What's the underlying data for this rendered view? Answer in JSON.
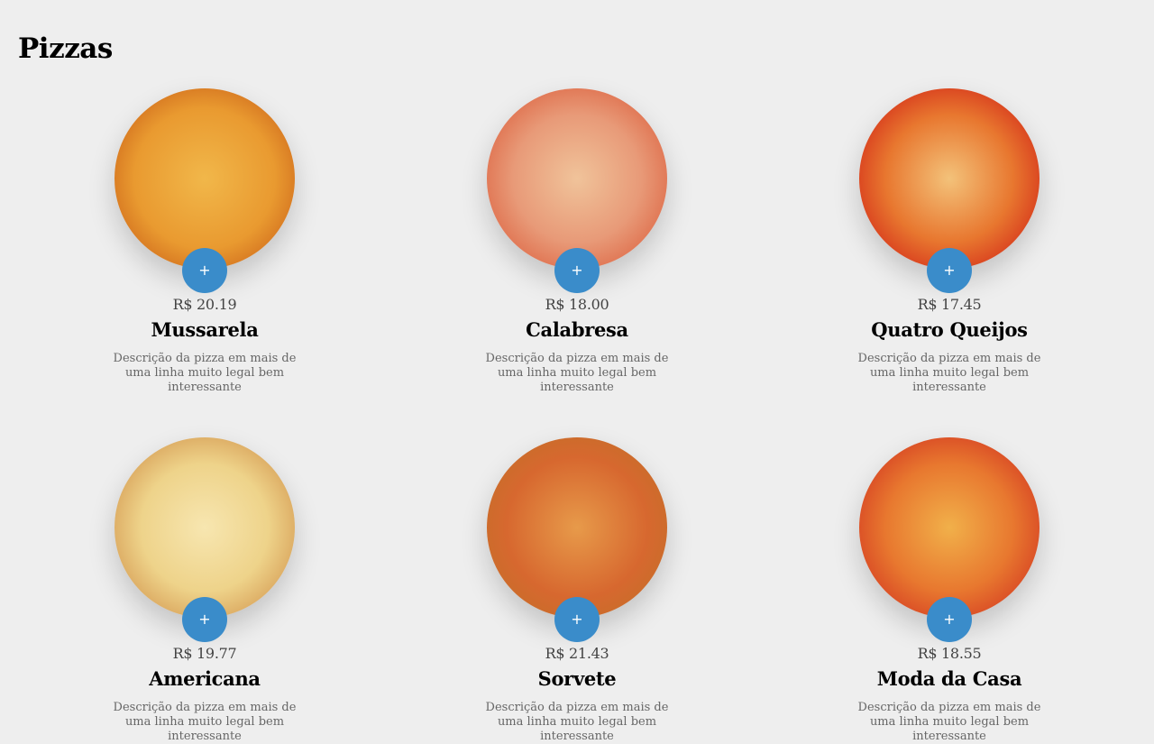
{
  "page": {
    "title": "Pizzas"
  },
  "add_label": "+",
  "colors": {
    "background": "#eeeeee",
    "add_button": "#3a8cca"
  },
  "pizzas": [
    {
      "price": "R$ 20.19",
      "name": "Mussarela",
      "description": "Descrição da pizza em mais de uma linha muito legal bem interessante"
    },
    {
      "price": "R$ 18.00",
      "name": "Calabresa",
      "description": "Descrição da pizza em mais de uma linha muito legal bem interessante"
    },
    {
      "price": "R$ 17.45",
      "name": "Quatro Queijos",
      "description": "Descrição da pizza em mais de uma linha muito legal bem interessante"
    },
    {
      "price": "R$ 19.77",
      "name": "Americana",
      "description": "Descrição da pizza em mais de uma linha muito legal bem interessante"
    },
    {
      "price": "R$ 21.43",
      "name": "Sorvete",
      "description": "Descrição da pizza em mais de uma linha muito legal bem interessante"
    },
    {
      "price": "R$ 18.55",
      "name": "Moda da Casa",
      "description": "Descrição da pizza em mais de uma linha muito legal bem interessante"
    }
  ]
}
